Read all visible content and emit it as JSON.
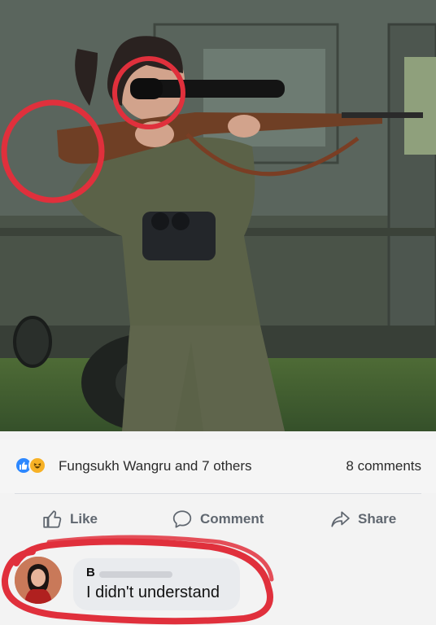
{
  "post": {
    "photo": {
      "description_icons": [
        "rifle-icon",
        "binoculars-icon",
        "scope-icon"
      ],
      "annotation_color": "#e0303c"
    },
    "reactions": {
      "icons": [
        "like-icon",
        "haha-icon"
      ],
      "names_text": "Fungsukh Wangru and 7 others",
      "comments_text": "8 comments"
    },
    "actions": {
      "like_label": "Like",
      "comment_label": "Comment",
      "share_label": "Share"
    },
    "comment": {
      "author_initial": "B",
      "text": "I didn't understand"
    }
  },
  "colors": {
    "like_blue": "#2d88ff",
    "haha_yellow": "#f7b125",
    "action_gray": "#606770",
    "highlight_red": "#e0303c"
  }
}
